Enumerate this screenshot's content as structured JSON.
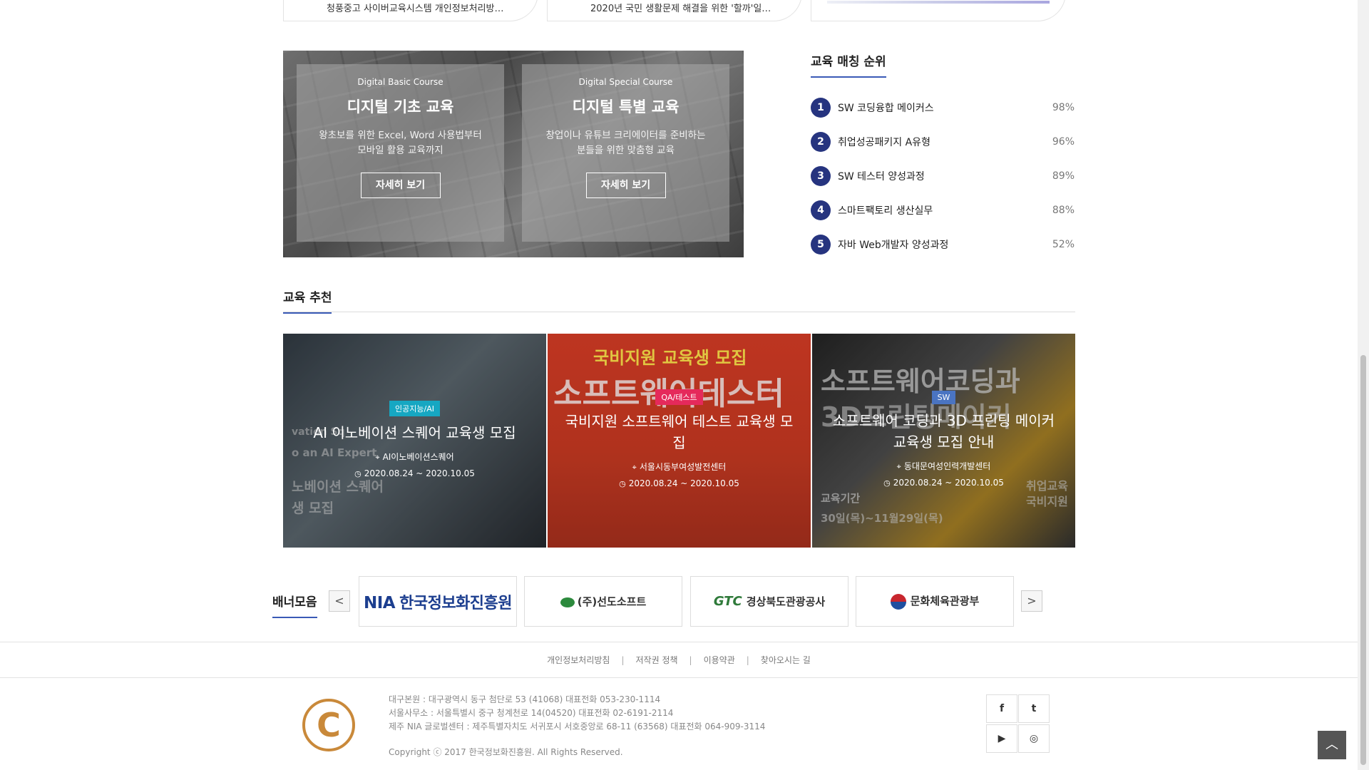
{
  "top_cards": [
    {
      "text": "청풍중고 사이버교육시스템 개인정보처리방…"
    },
    {
      "text": "2020년 국민 생활문제 해결을 위한 '할까'일…"
    }
  ],
  "courses": [
    {
      "eng": "Digital Basic Course",
      "title": "디지털 기초 교육",
      "desc": "왕초보를 위한 Excel, Word 사용법부터 모바일 활용 교육까지",
      "button": "자세히 보기"
    },
    {
      "eng": "Digital Special Course",
      "title": "디지털 특별 교육",
      "desc": "창업이나 유튜브 크리에이터를 준비하는 분들을 위한 맞춤형 교육",
      "button": "자세히 보기"
    }
  ],
  "ranking": {
    "title": "교육 매칭 순위",
    "items": [
      {
        "num": "1",
        "name": "SW 코딩융합 메이커스",
        "pct": "98%"
      },
      {
        "num": "2",
        "name": "취업성공패키지 A유형",
        "pct": "96%"
      },
      {
        "num": "3",
        "name": "SW 테스터 양성과정",
        "pct": "89%"
      },
      {
        "num": "4",
        "name": "스마트팩토리 생산실무",
        "pct": "88%"
      },
      {
        "num": "5",
        "name": "자바 Web개발자 양성과정",
        "pct": "52%"
      }
    ]
  },
  "recommend": {
    "title": "교육 추천",
    "cards": [
      {
        "tag": "인공지능/AI",
        "name": "AI 이노베이션 스퀘어 교육생 모집",
        "place": "AI이노베이션스퀘어",
        "period": "2020.08.24 ~ 2020.10.05",
        "bg1": "vation Sq",
        "bg2": "o an AI Expert",
        "bg3": "노베이션 스퀘어",
        "bg4": "생 모집"
      },
      {
        "tag": "QA/테스트",
        "name": "국비지원 소프트웨어 테스트 교육생 모집",
        "place": "서울시동부여성발전센터",
        "period": "2020.08.24 ~ 2020.10.05",
        "bg1": "국비지원 교육생 모집",
        "bg2": "소프트웨어테스터"
      },
      {
        "tag": "SW",
        "name": "소프트웨어 코딩과 3D 프린팅 메이커 교육생 모집 안내",
        "place": "동대문여성인력개발센터",
        "period": "2020.08.24 ~ 2020.10.05",
        "bg1": "소프트웨어코딩과",
        "bg2": "3D프린팅메이커",
        "bg3": "교육기간",
        "bg4": "30일(목)~11월29일(목)",
        "bg5": "취업교육",
        "bg6": "국비지원"
      }
    ]
  },
  "banners": {
    "title": "배너모음",
    "prev": "<",
    "next": ">",
    "items": [
      {
        "abbr": "NIA",
        "name": "한국정보화진흥원"
      },
      {
        "name": "(주)선도소프트"
      },
      {
        "abbr": "GTC",
        "name": "경상북도관광공사"
      },
      {
        "name": "문화체육관광부"
      }
    ]
  },
  "footer": {
    "links": [
      "개인정보처리방침",
      "저작권 정책",
      "이용약관",
      "찾아오시는 길"
    ],
    "info": [
      "대구본원 : 대구광역시 동구 첨단로 53 (41068) 대표전화 053-230-1114",
      "서울사무소 : 서울특별시 중구 청계천로 14(04520) 대표전화 02-6191-2114",
      "제주 NIA 글로벌센터 : 제주특별자치도 서귀포시 서호중앙로 68-11 (63568) 대표전화 064-909-3114"
    ],
    "copyright": "Copyright ⓒ 2017 한국정보화진흥원. All Rights Reserved.",
    "sns": {
      "facebook": "f",
      "twitter": "t",
      "youtube": "▶",
      "instagram": "◎"
    },
    "to_top": "︿"
  },
  "colors": {
    "accent": "#3a5ab6",
    "rank_badge": "#26347f"
  },
  "icons": {
    "location": "location-pin-icon",
    "clock": "clock-icon"
  }
}
